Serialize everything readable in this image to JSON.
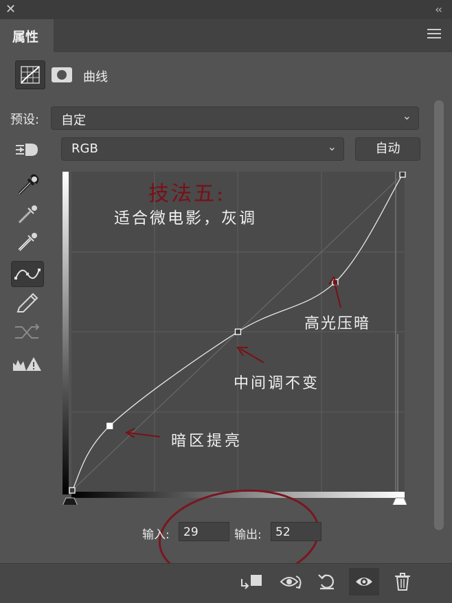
{
  "window": {
    "close_icon": "close-icon",
    "collapse_icon": "double-chevron-left-icon"
  },
  "tab": {
    "label": "属性"
  },
  "adjustment": {
    "type_label": "曲线"
  },
  "preset": {
    "label": "预设:",
    "value": "自定"
  },
  "channel": {
    "value": "RGB",
    "auto_label": "自动"
  },
  "annotations": {
    "title": "技法五:",
    "subtitle": "适合微电影，灰调",
    "highlights": "高光压暗",
    "midtones": "中间调不变",
    "shadows": "暗区提亮"
  },
  "io": {
    "input_label": "输入:",
    "input_value": "29",
    "output_label": "输出:",
    "output_value": "52"
  },
  "curve": {
    "points": [
      {
        "input": 0,
        "output": 0
      },
      {
        "input": 29,
        "output": 52
      },
      {
        "input": 128,
        "output": 128
      },
      {
        "input": 203,
        "output": 168
      },
      {
        "input": 255,
        "output": 255
      }
    ],
    "selected_index": 1
  },
  "colors": {
    "annotation_title": "#7a0f16",
    "annotation_arrow": "#7a0f16",
    "circle": "#7a1620"
  }
}
